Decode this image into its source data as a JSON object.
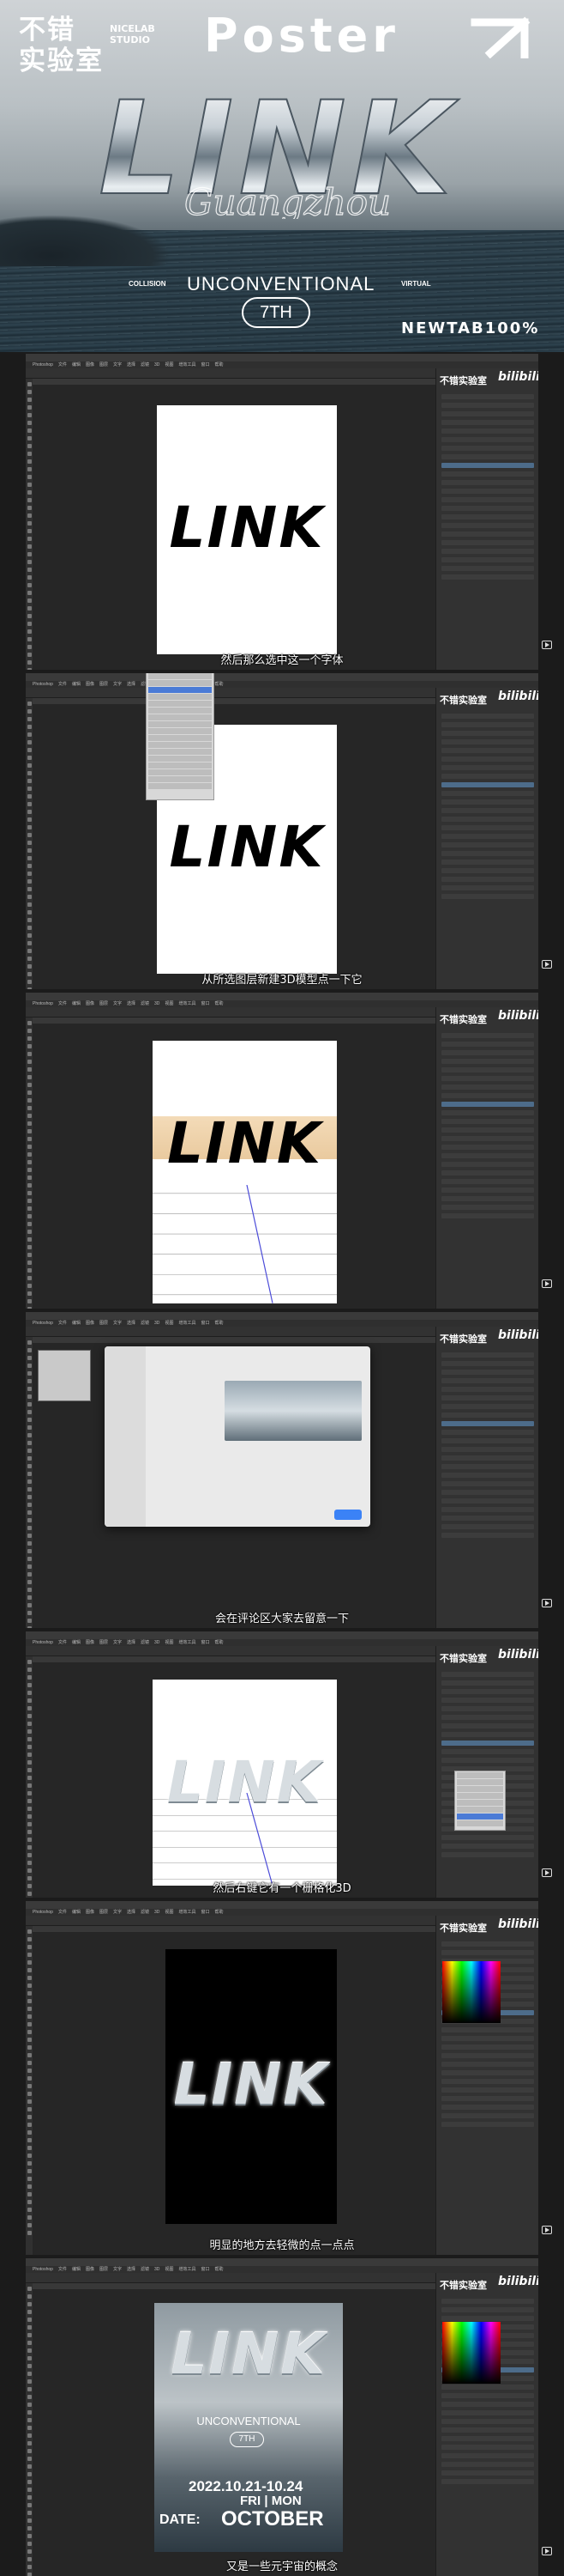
{
  "hero": {
    "brand_line1": "不错",
    "brand_line2": "实验室",
    "brand_en_line1": "NICELAB",
    "brand_en_line2": "STUDIO",
    "poster_word": "Poster",
    "logo_text": "LINK",
    "script_text": "Guangzhou",
    "collision": "COLLISION",
    "unconventional": "UNCONVENTIONAL",
    "virtual": "VIRTUAL",
    "seventh": "7TH",
    "newtab": "NEWTAB100%"
  },
  "watermark": {
    "channel": "不错实验室",
    "site": "bilibili"
  },
  "app": {
    "name": "Photoshop",
    "menus": [
      "Photoshop",
      "文件",
      "编辑",
      "图像",
      "图层",
      "文字",
      "选择",
      "滤镜",
      "3D",
      "视图",
      "增效工具",
      "窗口",
      "帮助"
    ]
  },
  "panels": [
    {
      "subtitle": "然后那么选中这一个字体",
      "logo": "LINK"
    },
    {
      "subtitle": "从所选图层新建3D模型点一下它",
      "logo": "LINK"
    },
    {
      "subtitle": "",
      "logo": "LINK"
    },
    {
      "subtitle": "会在评论区大家去留意一下"
    },
    {
      "subtitle": "然后右键它有一个栅格化3D",
      "logo": "LINK"
    },
    {
      "subtitle": "明显的地方去轻微的点一点点",
      "logo": "LINK"
    },
    {
      "subtitle": "又是一些元宇宙的概念",
      "logo": "LINK"
    }
  ],
  "final_poster": {
    "unconventional": "UNCONVENTIONAL",
    "seventh": "7TH",
    "dates": "2022.10.21-10.24",
    "fri_mon": "FRI | MON",
    "date_label": "DATE:",
    "month": "OCTOBER"
  }
}
